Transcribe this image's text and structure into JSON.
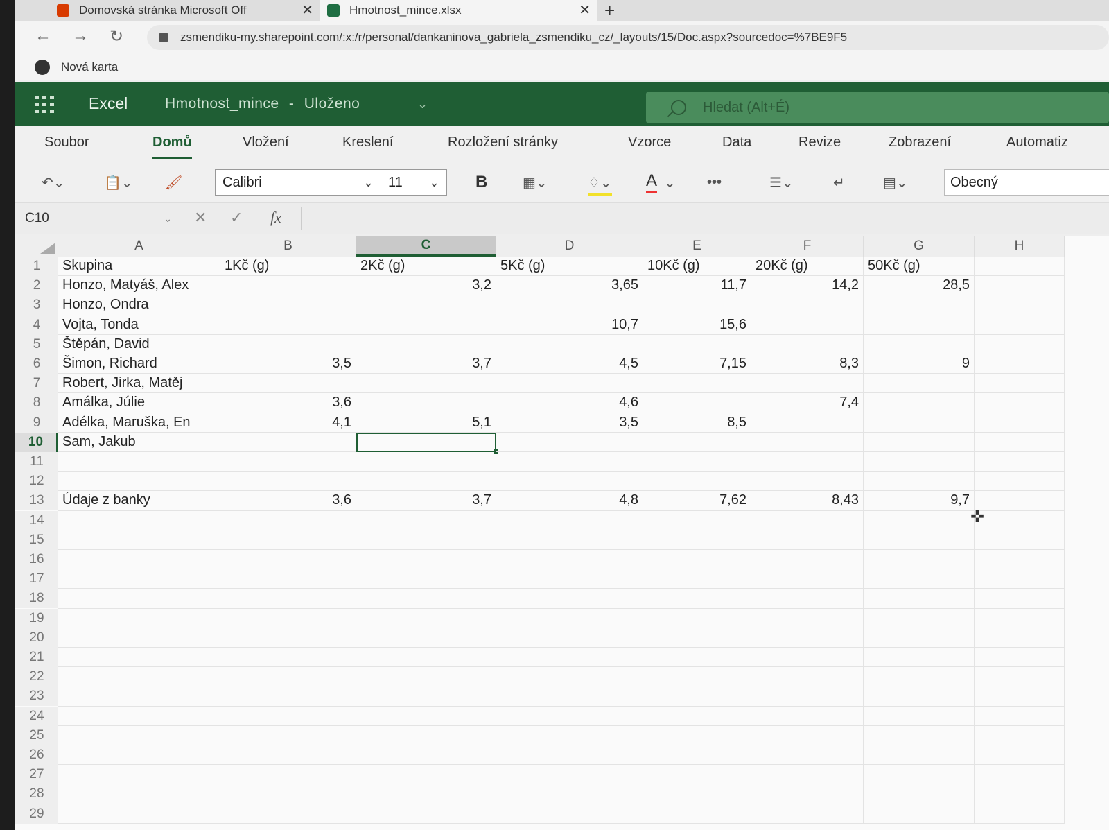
{
  "browser": {
    "tabs": [
      {
        "title": "Domovská stránka Microsoft Off",
        "icon": "office-icon",
        "color": "#d83b01"
      },
      {
        "title": "Hmotnost_mince.xlsx",
        "icon": "excel-icon",
        "color": "#1f6e43"
      }
    ],
    "new_tab": "+",
    "close": "✕",
    "url": "zsmendiku-my.sharepoint.com/:x:/r/personal/dankaninova_gabriela_zsmendiku_cz/_layouts/15/Doc.aspx?sourcedoc=%7BE9F5",
    "bookmark": "Nová karta"
  },
  "excel": {
    "app_name": "Excel",
    "doc_title": "Hmotnost_mince",
    "separator": "-",
    "save_state": "Uloženo",
    "search_placeholder": "Hledat (Alt+É)",
    "accent": "#1f5e34"
  },
  "ribbon": {
    "tabs": [
      "Soubor",
      "Domů",
      "Vložení",
      "Kreslení",
      "Rozložení stránky",
      "Vzorce",
      "Data",
      "Revize",
      "Zobrazení",
      "Automatiz"
    ],
    "active_tab": "Domů"
  },
  "toolbar": {
    "font_name": "Calibri",
    "font_size": "11",
    "bold": "B",
    "font_color_letter": "A",
    "more": "•••",
    "number_format": "Obecný"
  },
  "formula_bar": {
    "name_box": "C10",
    "fx": "fx",
    "content": ""
  },
  "sheet": {
    "columns": [
      "A",
      "B",
      "C",
      "D",
      "E",
      "F",
      "G",
      "H"
    ],
    "selected_column": "C",
    "selected_row": "10",
    "row_numbers": [
      "1",
      "2",
      "3",
      "4",
      "5",
      "6",
      "7",
      "8",
      "9",
      "10",
      "11",
      "12",
      "13",
      "14",
      "15",
      "16",
      "17",
      "18",
      "19",
      "20",
      "21",
      "22",
      "23",
      "24",
      "25",
      "26",
      "27",
      "28",
      "29"
    ],
    "rows": [
      [
        "Skupina",
        "1Kč (g)",
        "2Kč (g)",
        "5Kč (g)",
        "10Kč (g)",
        "20Kč (g)",
        "50Kč (g)",
        ""
      ],
      [
        "Honzo, Matyáš, Alex",
        "",
        "3,2",
        "3,65",
        "11,7",
        "14,2",
        "28,5",
        ""
      ],
      [
        "Honzo, Ondra",
        "",
        "",
        "",
        "",
        "",
        "",
        ""
      ],
      [
        "Vojta, Tonda",
        "",
        "",
        "10,7",
        "15,6",
        "",
        "",
        ""
      ],
      [
        "Štěpán, David",
        "",
        "",
        "",
        "",
        "",
        "",
        ""
      ],
      [
        "Šimon, Richard",
        "3,5",
        "3,7",
        "4,5",
        "7,15",
        "8,3",
        "9",
        ""
      ],
      [
        "Robert, Jirka, Matěj",
        "",
        "",
        "",
        "",
        "",
        "",
        ""
      ],
      [
        "Amálka, Júlie",
        "3,6",
        "",
        "4,6",
        "",
        "7,4",
        "",
        ""
      ],
      [
        "Adélka, Maruška, En",
        "4,1",
        "5,1",
        "3,5",
        "8,5",
        "",
        "",
        ""
      ],
      [
        "Sam, Jakub",
        "",
        "",
        "",
        "",
        "",
        "",
        ""
      ],
      [
        "",
        "",
        "",
        "",
        "",
        "",
        "",
        ""
      ],
      [
        "",
        "",
        "",
        "",
        "",
        "",
        "",
        ""
      ],
      [
        "Údaje z banky",
        "3,6",
        "3,7",
        "4,8",
        "7,62",
        "8,43",
        "9,7",
        ""
      ]
    ]
  }
}
